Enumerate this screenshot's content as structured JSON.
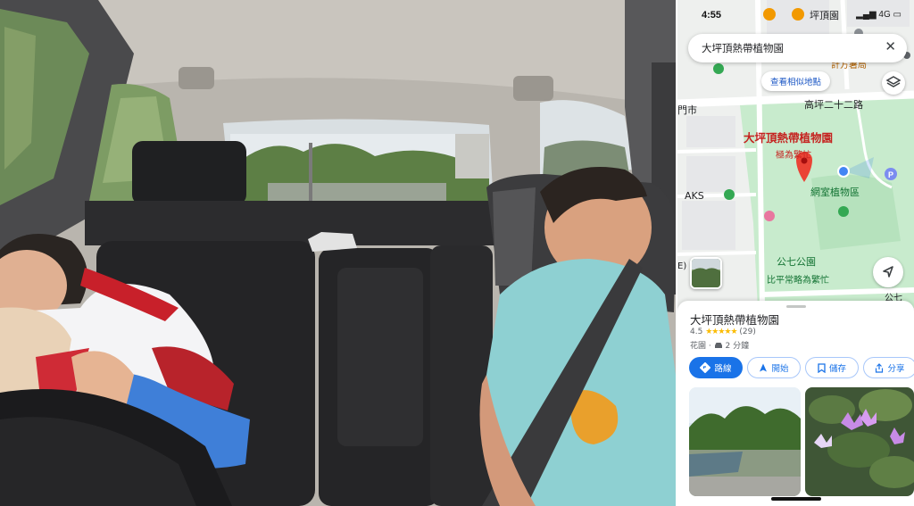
{
  "status_bar": {
    "time": "4:55",
    "signal_text": "4G"
  },
  "search": {
    "query": "大坪頂熱帶植物園"
  },
  "map": {
    "similar_places_chip": "查看相似地點",
    "labels": {
      "top_place": "坪頂園",
      "top_small": "計方暑局",
      "road": "高坪二十二路",
      "district_left": "門市",
      "selected_name": "大坪頂熱帶植物園",
      "selected_busy": "極為繁忙",
      "aks": "AKS",
      "greenhouse": "網室植物區",
      "park": "公七公園",
      "park_busy": "比平常略為繁忙",
      "edge_left": "E)",
      "edge_right": "公七"
    }
  },
  "place": {
    "name": "大坪頂熱帶植物園",
    "rating": "4.5",
    "stars": "★★★★★",
    "reviews": "(29)",
    "category": "花園",
    "drive_time": "2 分鐘",
    "buttons": {
      "directions": "路線",
      "start": "開始",
      "save": "儲存",
      "share": "分享"
    }
  },
  "colors": {
    "accent_blue": "#1a73e8",
    "map_green": "#c8ebcd",
    "pin_red": "#ea4335",
    "place_label_red": "#c5221f"
  },
  "icons": {
    "close": "close-icon",
    "layers": "layers-icon",
    "compass": "navigation-arrow-icon",
    "pin": "map-pin-icon",
    "directions": "directions-icon",
    "start": "navigation-icon",
    "save": "bookmark-icon",
    "share": "share-icon",
    "car": "car-icon"
  }
}
